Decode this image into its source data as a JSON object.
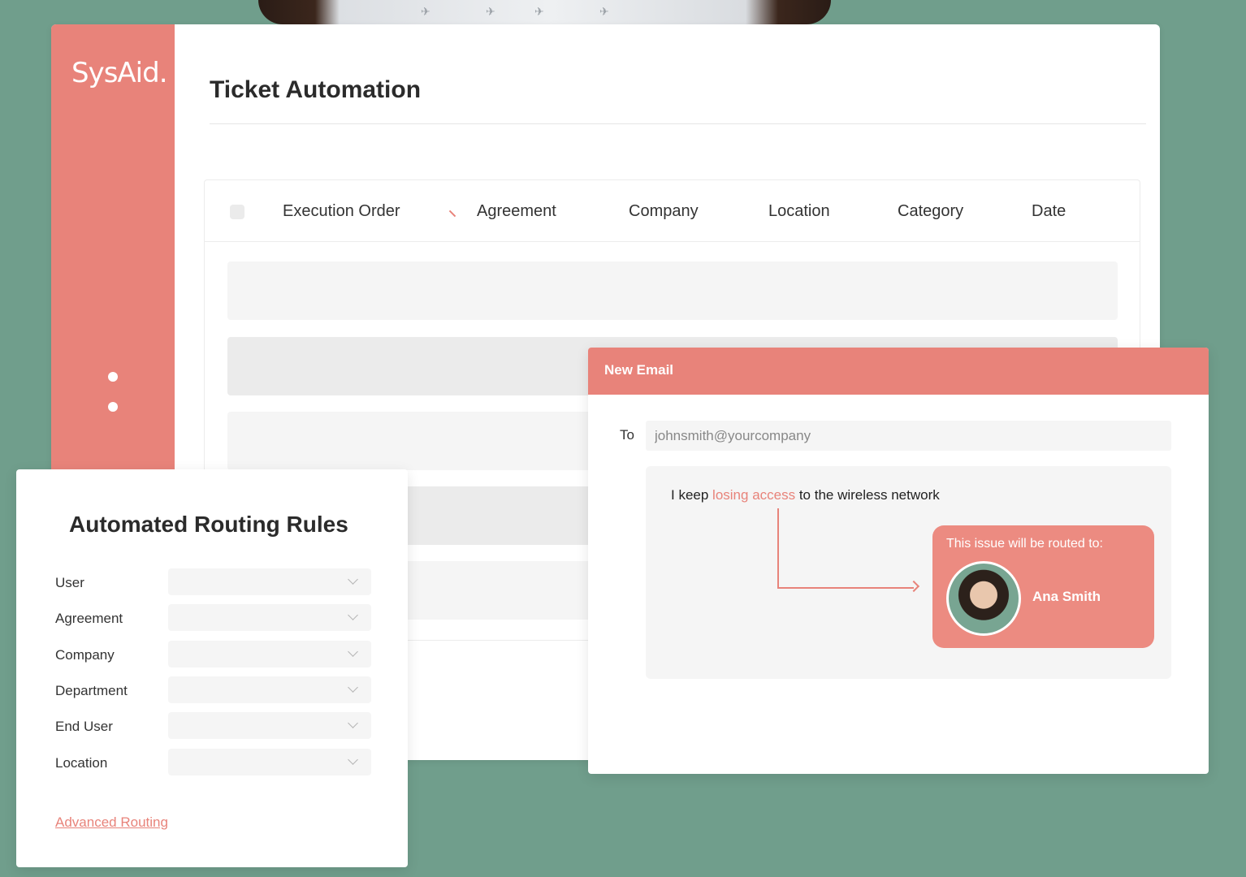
{
  "app": {
    "logo": "SysAid.",
    "title": "Ticket Automation"
  },
  "table": {
    "columns": [
      "Execution Order",
      "Agreement",
      "Company",
      "Location",
      "Category",
      "Date"
    ]
  },
  "email": {
    "header": "New Email",
    "to_label": "To",
    "to_value": "johnsmith@yourcompany",
    "message_before": "I keep ",
    "message_highlight": "losing access",
    "message_after": " to the wireless network",
    "route_title": "This issue will be routed to:",
    "route_name": "Ana Smith"
  },
  "rules": {
    "title": "Automated Routing Rules",
    "fields": [
      "User",
      "Agreement",
      "Company",
      "Department",
      "End User",
      "Location"
    ],
    "advanced_link": "Advanced Routing"
  },
  "colors": {
    "background": "#709e8c",
    "accent": "#e8837a"
  }
}
